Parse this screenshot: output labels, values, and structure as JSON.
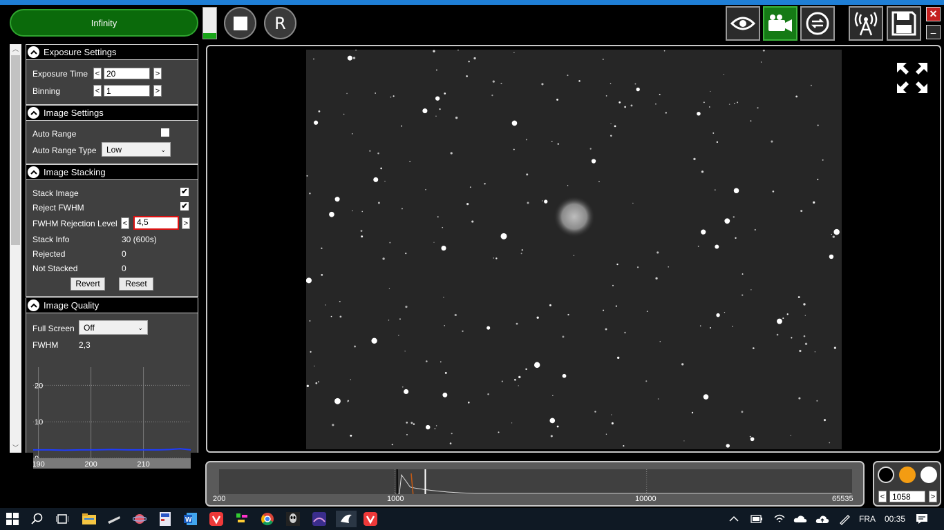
{
  "toolbar": {
    "status_button": "Infinity",
    "progress_fraction": 0.18,
    "reset_button": "R",
    "colors": {
      "active_green": "#157a15",
      "close_red": "#c42020"
    }
  },
  "exposure": {
    "header": "Exposure Settings",
    "exposure_time_label": "Exposure Time",
    "exposure_time_value": "20",
    "binning_label": "Binning",
    "binning_value": "1",
    "dec": "<",
    "inc": ">"
  },
  "image_settings": {
    "header": "Image Settings",
    "auto_range_label": "Auto Range",
    "auto_range_checked": false,
    "auto_range_type_label": "Auto Range Type",
    "auto_range_type_value": "Low"
  },
  "stacking": {
    "header": "Image Stacking",
    "stack_image_label": "Stack Image",
    "stack_image_checked": "✔",
    "reject_fwhm_label": "Reject FWHM",
    "reject_fwhm_checked": "✔",
    "fwhm_level_label": "FWHM Rejection Level",
    "fwhm_level_value": "4,5",
    "stack_info_label": "Stack Info",
    "stack_info_value": "30 (600s)",
    "rejected_label": "Rejected",
    "rejected_value": "0",
    "not_stacked_label": "Not Stacked",
    "not_stacked_value": "0",
    "revert_button": "Revert",
    "reset_button": "Reset"
  },
  "quality": {
    "header": "Image Quality",
    "full_screen_label": "Full Screen",
    "full_screen_value": "Off",
    "fwhm_label": "FWHM",
    "fwhm_value": "2,3"
  },
  "chart_data": {
    "type": "line",
    "title": "",
    "xlabel": "",
    "ylabel": "",
    "x_ticks": [
      "190",
      "200",
      "210"
    ],
    "y_ticks": [
      "0",
      "10",
      "20"
    ],
    "xlim": [
      189,
      219
    ],
    "ylim": [
      0,
      25
    ],
    "series": [
      {
        "color": "#1e3cff",
        "x": [
          189,
          192,
          195,
          198,
          201,
          204,
          207,
          210,
          213,
          215,
          217,
          219
        ],
        "y": [
          2.3,
          2.3,
          2.2,
          2.3,
          2.3,
          2.4,
          2.3,
          2.3,
          2.3,
          2.4,
          2.6,
          2.3
        ]
      }
    ]
  },
  "histogram": {
    "labels": [
      "200",
      "1000",
      "10000",
      "65535"
    ],
    "level_value": "1058",
    "dec": "<",
    "inc": ">"
  },
  "taskbar": {
    "language": "FRA",
    "time": "00:35"
  }
}
